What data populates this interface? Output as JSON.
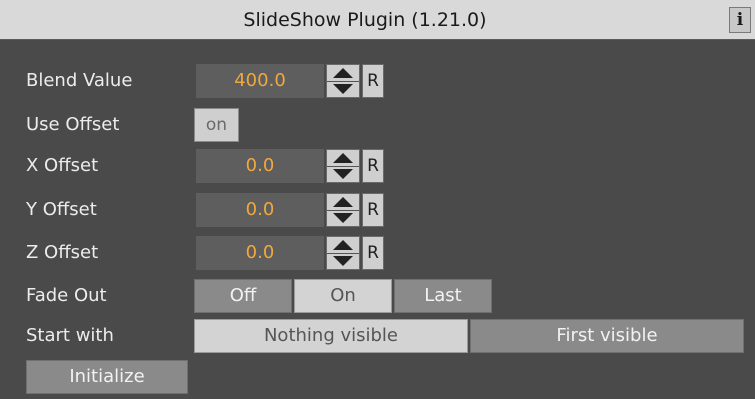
{
  "window": {
    "title": "SlideShow Plugin (1.21.0)",
    "info_label": "i"
  },
  "rows": {
    "blend_value": {
      "label": "Blend Value",
      "value": "400.0",
      "reset_label": "R"
    },
    "use_offset": {
      "label": "Use Offset",
      "toggle_label": "on"
    },
    "x_offset": {
      "label": "X Offset",
      "value": "0.0",
      "reset_label": "R"
    },
    "y_offset": {
      "label": "Y Offset",
      "value": "0.0",
      "reset_label": "R"
    },
    "z_offset": {
      "label": "Z Offset",
      "value": "0.0",
      "reset_label": "R"
    },
    "fade_out": {
      "label": "Fade Out",
      "options": [
        "Off",
        "On",
        "Last"
      ],
      "selected": "On"
    },
    "start_with": {
      "label": "Start with",
      "options": [
        "Nothing visible",
        "First visible"
      ],
      "selected": "Nothing visible"
    }
  },
  "actions": {
    "initialize_label": "Initialize"
  },
  "colors": {
    "value_text": "#f0a83e",
    "panel_bg": "#4a4a4a",
    "titlebar_bg": "#d9d9d9"
  },
  "icons": {
    "spinner": "up-down-arrows-icon",
    "info": "info-icon"
  }
}
